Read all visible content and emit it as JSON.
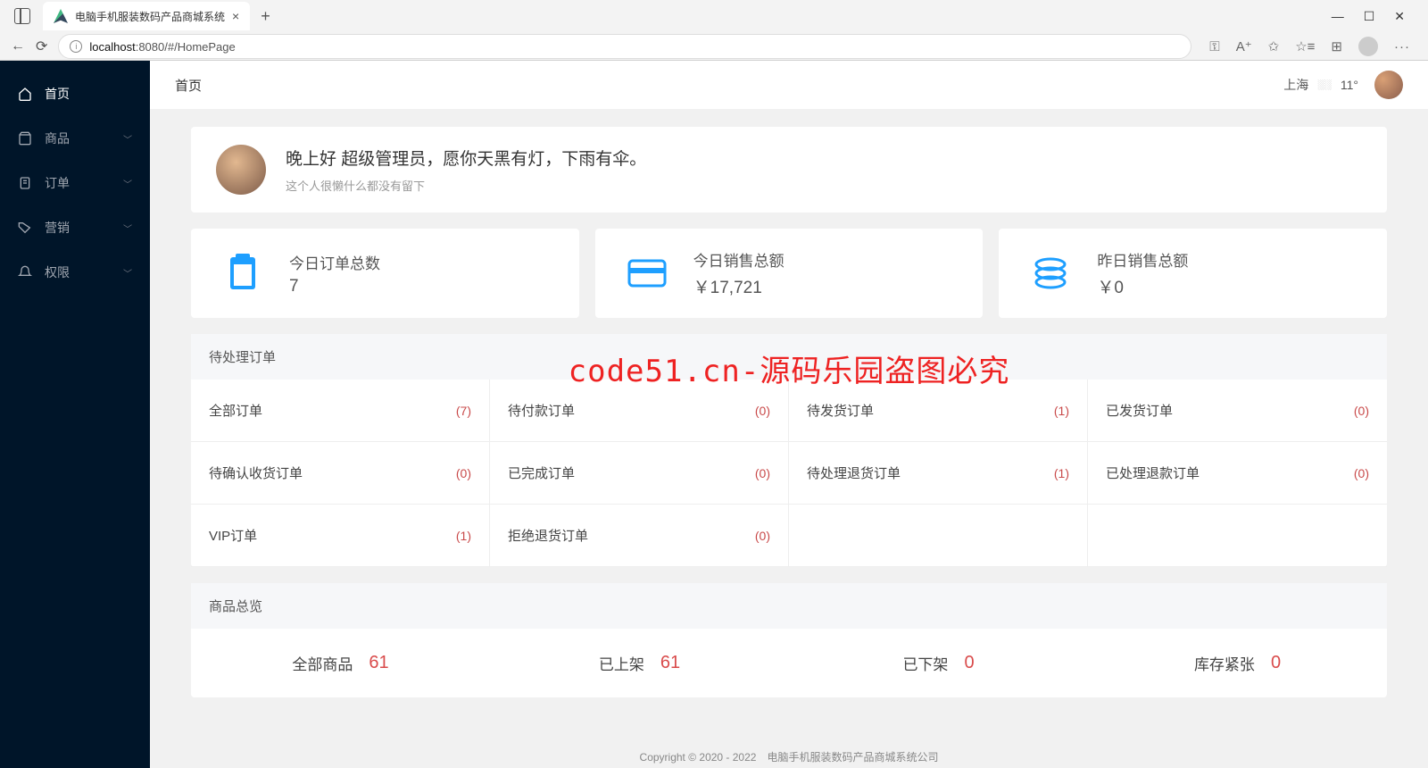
{
  "browser": {
    "tab_title": "电脑手机服装数码产品商城系统",
    "url_host": "localhost",
    "url_rest": ":8080/#/HomePage"
  },
  "sidebar": {
    "items": [
      {
        "label": "首页",
        "icon": "home",
        "active": true,
        "expandable": false
      },
      {
        "label": "商品",
        "icon": "bag",
        "active": false,
        "expandable": true
      },
      {
        "label": "订单",
        "icon": "clipboard",
        "active": false,
        "expandable": true
      },
      {
        "label": "营销",
        "icon": "tag",
        "active": false,
        "expandable": true
      },
      {
        "label": "权限",
        "icon": "bell",
        "active": false,
        "expandable": true
      }
    ]
  },
  "topbar": {
    "breadcrumb": "首页",
    "city": "上海",
    "temp": "11°"
  },
  "greeting": {
    "title": "晚上好 超级管理员，愿你天黑有灯，下雨有伞。",
    "subtitle": "这个人很懒什么都没有留下"
  },
  "stats": [
    {
      "label": "今日订单总数",
      "value": "7",
      "icon": "clipboard"
    },
    {
      "label": "今日销售总额",
      "value": "￥17,721",
      "icon": "card"
    },
    {
      "label": "昨日销售总额",
      "value": "￥0",
      "icon": "coins"
    }
  ],
  "pending": {
    "title": "待处理订单",
    "items": [
      {
        "name": "全部订单",
        "count": "(7)"
      },
      {
        "name": "待付款订单",
        "count": "(0)"
      },
      {
        "name": "待发货订单",
        "count": "(1)"
      },
      {
        "name": "已发货订单",
        "count": "(0)"
      },
      {
        "name": "待确认收货订单",
        "count": "(0)"
      },
      {
        "name": "已完成订单",
        "count": "(0)"
      },
      {
        "name": "待处理退货订单",
        "count": "(1)"
      },
      {
        "name": "已处理退款订单",
        "count": "(0)"
      },
      {
        "name": "VIP订单",
        "count": "(1)"
      },
      {
        "name": "拒绝退货订单",
        "count": "(0)"
      }
    ]
  },
  "overview": {
    "title": "商品总览",
    "items": [
      {
        "label": "全部商品",
        "value": "61"
      },
      {
        "label": "已上架",
        "value": "61"
      },
      {
        "label": "已下架",
        "value": "0"
      },
      {
        "label": "库存紧张",
        "value": "0"
      }
    ]
  },
  "watermark": "code51.cn-源码乐园盗图必究",
  "footer": "Copyright © 2020 - 2022　电脑手机服装数码产品商城系统公司"
}
